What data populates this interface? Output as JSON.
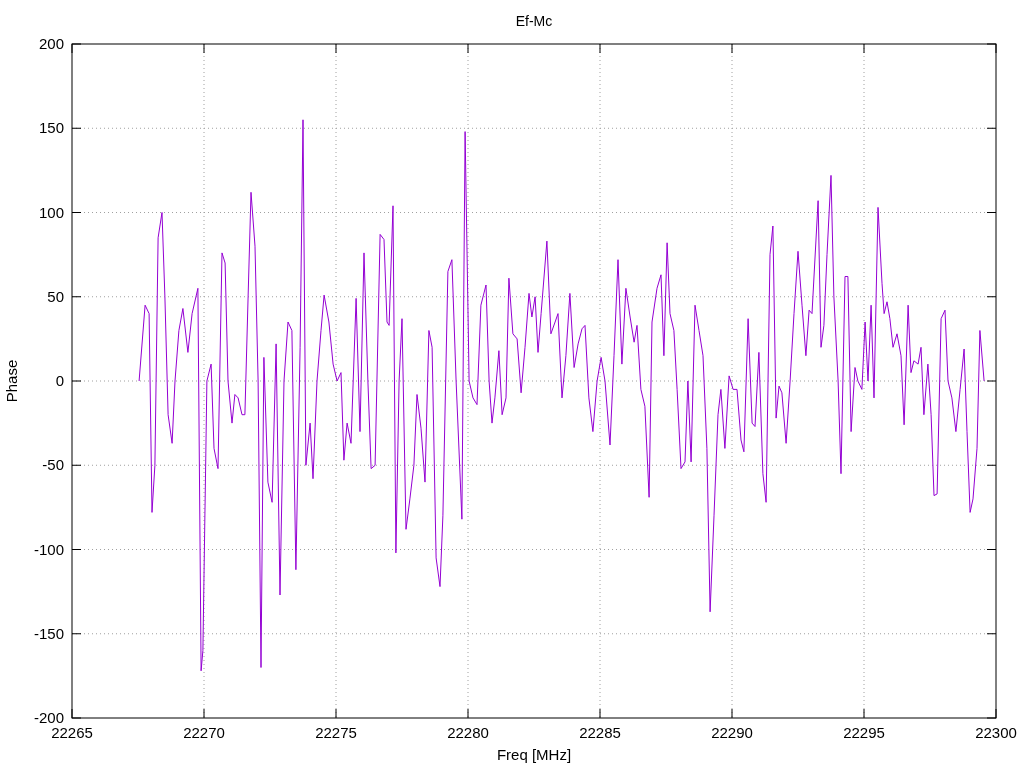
{
  "chart": {
    "chart_data": {
      "type": "line",
      "title": "Ef-Mc",
      "xlabel": "Freq [MHz]",
      "ylabel": "Phase",
      "grid": true,
      "xlim": [
        22265,
        22300
      ],
      "ylim": [
        -200,
        200
      ],
      "xticks": [
        22265,
        22270,
        22275,
        22280,
        22285,
        22290,
        22295,
        22300
      ],
      "yticks": [
        -200,
        -150,
        -100,
        -50,
        0,
        50,
        100,
        150,
        200
      ],
      "x": [
        22267.54,
        22267.77,
        22267.92,
        22268.03,
        22268.14,
        22268.26,
        22268.41,
        22268.52,
        22268.64,
        22268.79,
        22268.9,
        22269.05,
        22269.2,
        22269.39,
        22269.55,
        22269.77,
        22269.89,
        22269.96,
        22270.11,
        22270.27,
        22270.38,
        22270.53,
        22270.68,
        22270.8,
        22270.91,
        22271.06,
        22271.17,
        22271.29,
        22271.44,
        22271.55,
        22271.67,
        22271.78,
        22271.93,
        22272.05,
        22272.16,
        22272.27,
        22272.42,
        22272.58,
        22272.73,
        22272.88,
        22273.03,
        22273.18,
        22273.33,
        22273.48,
        22273.64,
        22273.75,
        22273.86,
        22274.02,
        22274.13,
        22274.28,
        22274.43,
        22274.55,
        22274.73,
        22274.89,
        22275.04,
        22275.19,
        22275.3,
        22275.42,
        22275.57,
        22275.76,
        22275.91,
        22276.06,
        22276.21,
        22276.33,
        22276.48,
        22276.67,
        22276.82,
        22276.93,
        22277.01,
        22277.16,
        22277.27,
        22277.39,
        22277.5,
        22277.65,
        22277.8,
        22277.95,
        22278.07,
        22278.22,
        22278.37,
        22278.52,
        22278.64,
        22278.79,
        22278.94,
        22279.05,
        22279.24,
        22279.39,
        22279.55,
        22279.77,
        22279.89,
        22280.04,
        22280.19,
        22280.34,
        22280.49,
        22280.68,
        22280.8,
        22280.91,
        22281.02,
        22281.17,
        22281.29,
        22281.44,
        22281.55,
        22281.7,
        22281.86,
        22282.01,
        22282.16,
        22282.31,
        22282.42,
        22282.54,
        22282.65,
        22282.77,
        22282.99,
        22283.14,
        22283.3,
        22283.41,
        22283.56,
        22283.71,
        22283.86,
        22284.02,
        22284.17,
        22284.32,
        22284.43,
        22284.58,
        22284.73,
        22284.89,
        22285.04,
        22285.19,
        22285.38,
        22285.53,
        22285.68,
        22285.83,
        22285.98,
        22286.14,
        22286.29,
        22286.4,
        22286.55,
        22286.7,
        22286.86,
        22286.97,
        22287.16,
        22287.31,
        22287.42,
        22287.54,
        22287.65,
        22287.8,
        22287.92,
        22288.07,
        22288.22,
        22288.33,
        22288.45,
        22288.6,
        22288.75,
        22288.9,
        22289.05,
        22289.17,
        22289.32,
        22289.47,
        22289.58,
        22289.73,
        22289.89,
        22290.04,
        22290.19,
        22290.34,
        22290.45,
        22290.61,
        22290.76,
        22290.87,
        22291.02,
        22291.17,
        22291.29,
        22291.44,
        22291.55,
        22291.67,
        22291.78,
        22291.89,
        22292.05,
        22292.2,
        22292.35,
        22292.5,
        22292.65,
        22292.8,
        22292.92,
        22293.03,
        22293.26,
        22293.37,
        22293.48,
        22293.6,
        22293.75,
        22293.86,
        22294.02,
        22294.13,
        22294.28,
        22294.39,
        22294.51,
        22294.66,
        22294.77,
        22294.92,
        22295.04,
        22295.15,
        22295.27,
        22295.38,
        22295.53,
        22295.68,
        22295.76,
        22295.87,
        22295.98,
        22296.1,
        22296.25,
        22296.4,
        22296.52,
        22296.67,
        22296.78,
        22296.89,
        22297.05,
        22297.16,
        22297.27,
        22297.42,
        22297.54,
        22297.65,
        22297.77,
        22297.92,
        22298.07,
        22298.18,
        22298.33,
        22298.48,
        22298.64,
        22298.79,
        22298.9,
        22299.02,
        22299.13,
        22299.28,
        22299.39,
        22299.55
      ],
      "series": [
        {
          "color": "#9400d3",
          "values": [
            0,
            45,
            40,
            -78,
            -50,
            85,
            100,
            50,
            -20,
            -37,
            0,
            30,
            43,
            17,
            40,
            55,
            -172,
            -160,
            0,
            10,
            -40,
            -52,
            76,
            70,
            0,
            -25,
            -8,
            -10,
            -20,
            -20,
            50,
            112,
            80,
            0,
            -170,
            14,
            -60,
            -72,
            22,
            -127,
            0,
            35,
            30,
            -112,
            20,
            155,
            -50,
            -25,
            -58,
            0,
            30,
            51,
            35,
            10,
            0,
            5,
            -47,
            -25,
            -37,
            49,
            -30,
            76,
            0,
            -52,
            -50,
            87,
            84,
            35,
            33,
            104,
            -102,
            0,
            37,
            -88,
            -70,
            -50,
            -8,
            -28,
            -60,
            30,
            20,
            -105,
            -122,
            -80,
            65,
            72,
            0,
            -82,
            148,
            0,
            -10,
            -14,
            45,
            57,
            0,
            -25,
            -10,
            18,
            -20,
            -10,
            61,
            28,
            25,
            -7,
            20,
            52,
            38,
            50,
            17,
            40,
            83,
            28,
            35,
            40,
            -10,
            15,
            52,
            8,
            22,
            31,
            33,
            -10,
            -30,
            0,
            14,
            0,
            -38,
            15,
            72,
            10,
            55,
            38,
            23,
            33,
            -5,
            -15,
            -69,
            35,
            55,
            63,
            15,
            82,
            40,
            30,
            -5,
            -52,
            -48,
            0,
            -48,
            45,
            30,
            15,
            -40,
            -137,
            -80,
            -20,
            -5,
            -40,
            3,
            -5,
            -5,
            -35,
            -42,
            37,
            -25,
            -27,
            17,
            -55,
            -72,
            75,
            92,
            -22,
            -3,
            -7,
            -37,
            0,
            40,
            77,
            45,
            15,
            42,
            40,
            107,
            20,
            33,
            75,
            122,
            50,
            0,
            -55,
            62,
            62,
            -30,
            8,
            0,
            -5,
            35,
            0,
            45,
            -10,
            103,
            58,
            40,
            47,
            37,
            20,
            28,
            15,
            -26,
            45,
            5,
            12,
            10,
            20,
            -20,
            10,
            -20,
            -68,
            -67,
            37,
            42,
            0,
            -10,
            -30,
            -5,
            19,
            -30,
            -78,
            -70,
            -40,
            30,
            0
          ]
        }
      ]
    }
  }
}
